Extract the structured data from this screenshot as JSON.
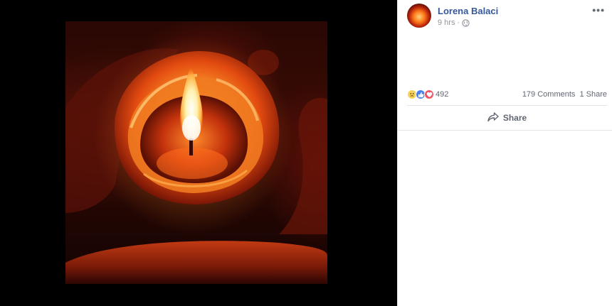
{
  "post": {
    "author": "Lorena Balaci",
    "time": "9 hrs",
    "separator": "·",
    "more_glyph": "•••"
  },
  "reactions": {
    "count": "492",
    "types": [
      "sad-icon",
      "like-icon",
      "love-icon"
    ],
    "comments": "179 Comments",
    "shares": "1 Share"
  },
  "actions": {
    "share_label": "Share"
  },
  "colors": {
    "author_link": "#365899",
    "meta_gray": "#90949c",
    "viewer_bg": "#000000",
    "like_blue": "#4a7ff0",
    "love_red": "#f25268",
    "sad_yellow": "#f7d25a"
  }
}
